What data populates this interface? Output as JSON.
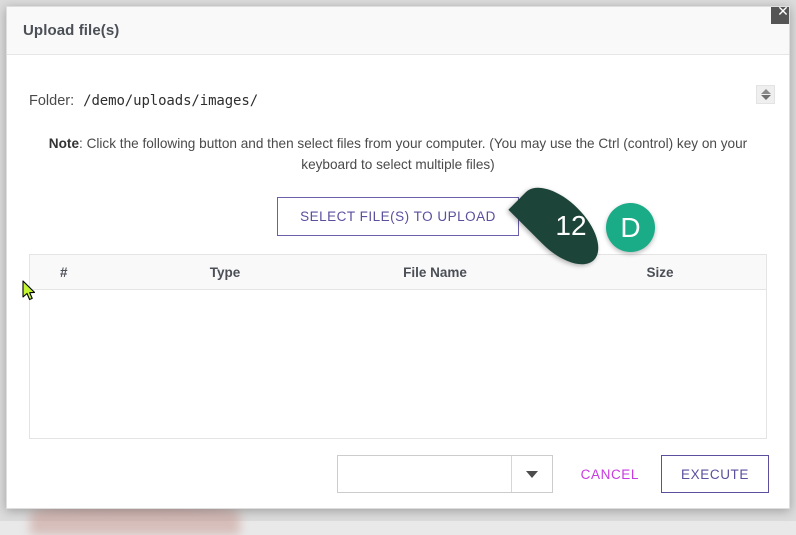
{
  "dialog": {
    "title": "Upload file(s)",
    "close_icon": "close-icon"
  },
  "folder": {
    "label": "Folder:",
    "path": "/demo/uploads/images/",
    "spinner_icon": "updown-spinner-icon"
  },
  "note": {
    "strong": "Note",
    "text": ": Click the following button and then select files from your computer. (You may use the Ctrl (control) key on your keyboard to select multiple files)"
  },
  "select_files": {
    "label": "SELECT FILE(S) TO UPLOAD"
  },
  "annotations": {
    "step_number": "12",
    "marker_letter": "D",
    "teardrop_color": "#1c4438",
    "circle_color": "#1aab87"
  },
  "file_table": {
    "columns": [
      "#",
      "Type",
      "File Name",
      "Size"
    ],
    "rows": []
  },
  "footer": {
    "mode_value": "",
    "mode_placeholder": "",
    "caret_icon": "chevron-down-icon",
    "cancel_label": "CANCEL",
    "execute_label": "EXECUTE"
  },
  "colors": {
    "accent_purple": "#5b4f9e",
    "cancel_magenta": "#c83ae0",
    "header_band": "#f9f9f9"
  }
}
